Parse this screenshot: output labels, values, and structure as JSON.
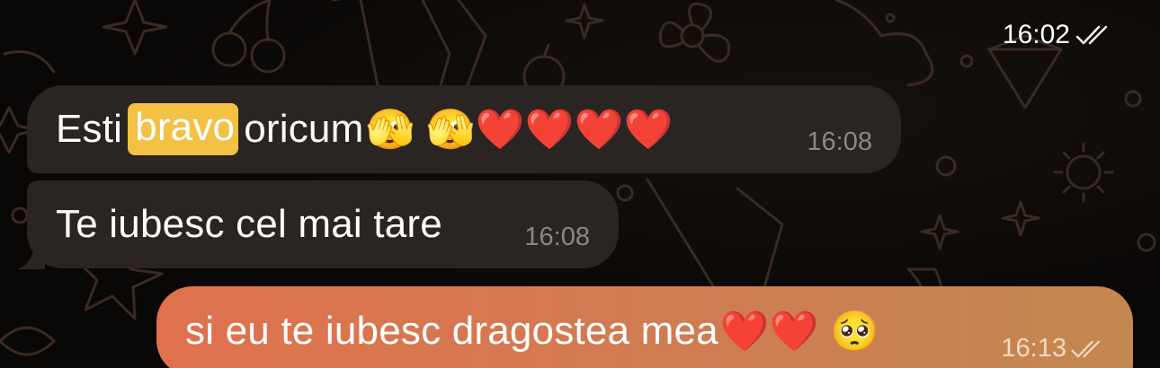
{
  "top": {
    "time": "16:02",
    "status_icon": "double-check-icon"
  },
  "messages": [
    {
      "direction": "incoming",
      "before": "Esti",
      "highlight": "bravo",
      "after": "oricum",
      "emojis": "🫣 🫣❤️❤️❤️❤️",
      "time": "16:08"
    },
    {
      "direction": "incoming",
      "text": "Te iubesc cel mai tare",
      "time": "16:08"
    },
    {
      "direction": "outgoing",
      "text": "si eu te iubesc dragostea mea",
      "emojis": "❤️❤️ 🥺",
      "time": "16:13",
      "status_icon": "double-check-icon"
    }
  ],
  "colors": {
    "incoming_bubble": "#2a2522",
    "outgoing_start": "#e0714d",
    "outgoing_end": "#c3884f",
    "highlight": "#f3c143"
  }
}
